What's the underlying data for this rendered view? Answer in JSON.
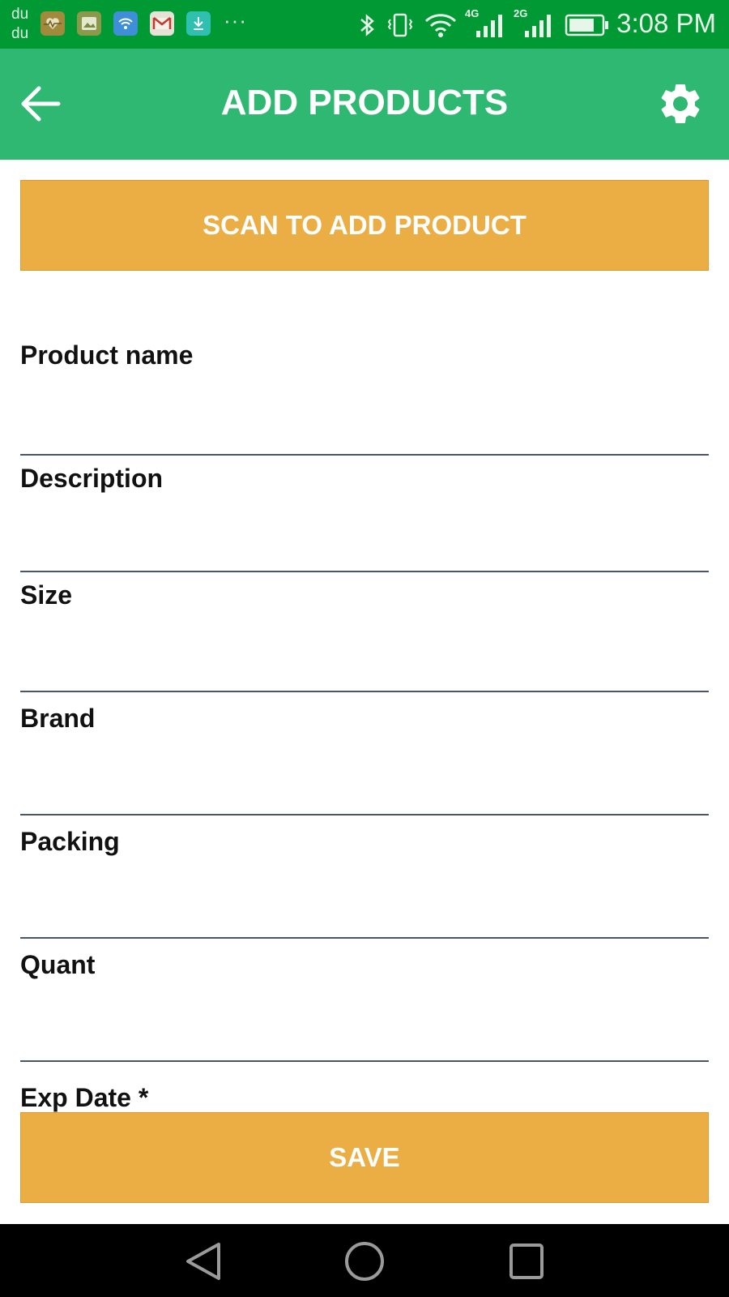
{
  "status_bar": {
    "carrier_line1": "du",
    "carrier_line2": "du",
    "overflow": "···",
    "network_4g": "4G",
    "network_2g": "2G",
    "time": "3:08 PM",
    "icons": [
      "health-app-icon",
      "gallery-icon",
      "wifi-app-icon",
      "gmail-icon",
      "download-icon",
      "bluetooth-icon",
      "vibrate-icon",
      "wifi-icon",
      "signal-icon",
      "signal-icon",
      "battery-icon"
    ],
    "color": "#009933"
  },
  "app_bar": {
    "title": "ADD PRODUCTS",
    "back_icon": "arrow-back-icon",
    "settings_icon": "gear-icon",
    "color": "#2fb871"
  },
  "scan_button": {
    "label": "SCAN TO ADD PRODUCT",
    "color": "#ebae45"
  },
  "form": {
    "fields": [
      {
        "label": "Product name",
        "value": ""
      },
      {
        "label": "Description",
        "value": ""
      },
      {
        "label": "Size",
        "value": ""
      },
      {
        "label": "Brand",
        "value": ""
      },
      {
        "label": "Packing",
        "value": ""
      },
      {
        "label": "Quant",
        "value": ""
      },
      {
        "label": "Exp Date *",
        "value": ""
      }
    ]
  },
  "save_button": {
    "label": "SAVE",
    "color": "#ebae45"
  },
  "nav_bar": {
    "icons": [
      "nav-back-icon",
      "nav-home-icon",
      "nav-recents-icon"
    ]
  }
}
